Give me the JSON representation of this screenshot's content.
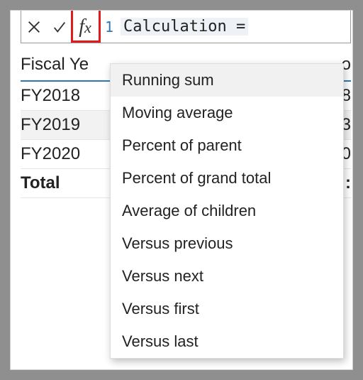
{
  "formula_bar": {
    "line_number": "1",
    "formula_text": "Calculation ="
  },
  "table": {
    "header_year": "Fiscal Ye",
    "header_right_fragment": "o",
    "rows": [
      {
        "year": "FY2018",
        "value_fragment": "8"
      },
      {
        "year": "FY2019",
        "value_fragment": "3"
      },
      {
        "year": "FY2020",
        "value_fragment": "0"
      }
    ],
    "total_label": "Total",
    "total_value_fragment": ":"
  },
  "dropdown": {
    "items": [
      "Running sum",
      "Moving average",
      "Percent of parent",
      "Percent of grand total",
      "Average of children",
      "Versus previous",
      "Versus next",
      "Versus first",
      "Versus last"
    ]
  },
  "icons": {
    "cancel": "cancel-icon",
    "commit": "commit-icon",
    "fx": "fx-icon"
  }
}
